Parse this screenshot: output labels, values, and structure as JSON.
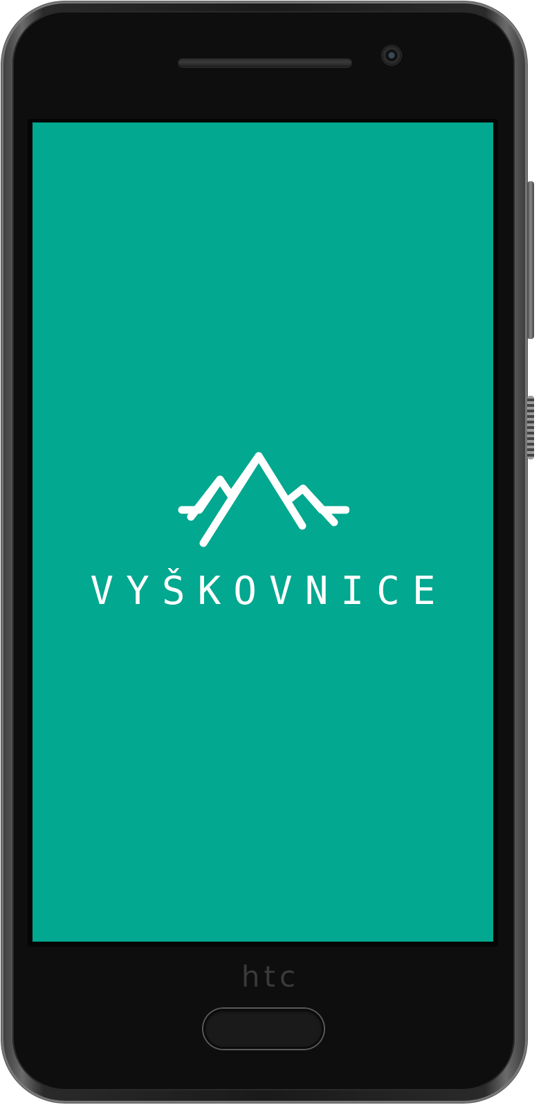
{
  "device": {
    "brand_label": "htc",
    "body_color": "#0e0e0e"
  },
  "app": {
    "logo_text": "VYŠKOVNICE",
    "logo_icon": "mountain-peaks-icon",
    "background_color": "#02a88f",
    "foreground_color": "#ffffff"
  }
}
